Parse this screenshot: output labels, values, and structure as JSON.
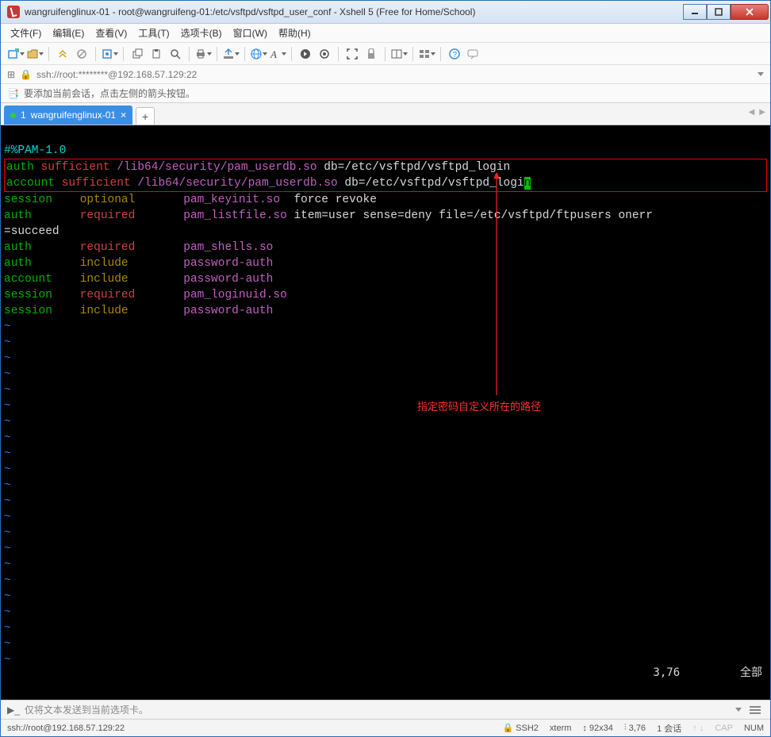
{
  "window": {
    "title": "wangruifenglinux-01 - root@wangruifeng-01:/etc/vsftpd/vsftpd_user_conf - Xshell 5 (Free for Home/School)"
  },
  "menu": {
    "file": "文件(F)",
    "edit": "编辑(E)",
    "view": "查看(V)",
    "tools": "工具(T)",
    "options": "选项卡(B)",
    "window": "窗口(W)",
    "help": "帮助(H)"
  },
  "addressbar": {
    "url": "ssh://root:********@192.168.57.129:22"
  },
  "infobar": {
    "text": "要添加当前会话，点击左侧的箭头按钮。"
  },
  "tab": {
    "index": "1",
    "label": "wangruifenglinux-01"
  },
  "terminal": {
    "header": "#%PAM-1.0",
    "boxed_line1": {
      "t1": "auth",
      "t2": "sufficient",
      "t3": "/lib64/security/pam_userdb.so",
      "t4": "db=/etc/vsftpd/vsftpd_login"
    },
    "boxed_line2": {
      "t1": "account",
      "t2": "sufficient",
      "t3": "/lib64/security/pam_userdb.so",
      "t4": "db=/etc/vsftpd/vsftpd_logi",
      "cur": "n"
    },
    "lines": [
      {
        "c1": "session",
        "c2": "optional",
        "c3": "pam_keyinit.so",
        "c4": "force revoke",
        "col": [
          "green",
          "yellow",
          "magenta",
          "white"
        ]
      },
      {
        "c1": "auth",
        "c2": "required",
        "c3": "pam_listfile.so",
        "c4": "item=user sense=deny file=/etc/vsftpd/ftpusers onerr",
        "col": [
          "green",
          "red",
          "magenta",
          "white"
        ]
      },
      {
        "c1": "=succeed",
        "col": [
          "white"
        ]
      },
      {
        "c1": "auth",
        "c2": "required",
        "c3": "pam_shells.so",
        "col": [
          "green",
          "red",
          "magenta"
        ]
      },
      {
        "c1": "auth",
        "c2": "include",
        "c3": "password-auth",
        "col": [
          "green",
          "yellow",
          "magenta"
        ]
      },
      {
        "c1": "account",
        "c2": "include",
        "c3": "password-auth",
        "col": [
          "green",
          "yellow",
          "magenta"
        ]
      },
      {
        "c1": "session",
        "c2": "required",
        "c3": "pam_loginuid.so",
        "col": [
          "green",
          "red",
          "magenta"
        ]
      },
      {
        "c1": "session",
        "c2": "include",
        "c3": "password-auth",
        "col": [
          "green",
          "yellow",
          "magenta"
        ]
      }
    ],
    "tilde": "~",
    "status_pos": "3,76",
    "status_all": "全部"
  },
  "annotation": {
    "text": "指定密码自定义所在的路径"
  },
  "sendbar": {
    "placeholder": "仅将文本发送到当前选项卡。"
  },
  "statusbar": {
    "conn": "ssh://root@192.168.57.129:22",
    "ssh": "SSH2",
    "term": "xterm",
    "size": "92x34",
    "pos": "3,76",
    "sessions": "1 会话",
    "cap": "CAP",
    "num": "NUM"
  }
}
